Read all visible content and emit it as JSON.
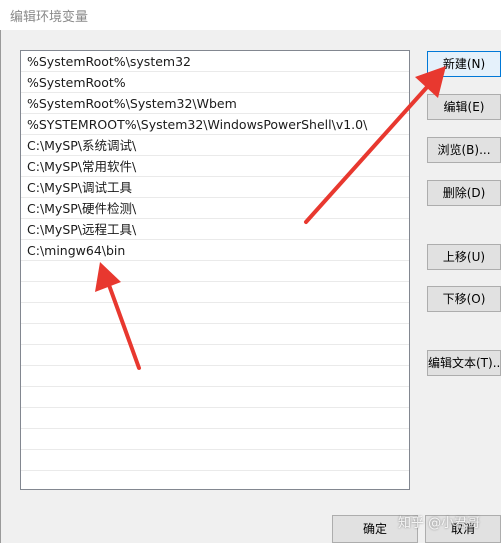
{
  "window": {
    "title": "编辑环境变量"
  },
  "list": {
    "items": [
      "%SystemRoot%\\system32",
      "%SystemRoot%",
      "%SystemRoot%\\System32\\Wbem",
      "%SYSTEMROOT%\\System32\\WindowsPowerShell\\v1.0\\",
      "C:\\MySP\\系统调试\\",
      "C:\\MySP\\常用软件\\",
      "C:\\MySP\\调试工具",
      "C:\\MySP\\硬件检测\\",
      "C:\\MySP\\远程工具\\",
      "C:\\mingw64\\bin",
      "",
      "",
      "",
      "",
      "",
      "",
      "",
      "",
      "",
      ""
    ]
  },
  "buttons": {
    "new": "新建(N)",
    "edit": "编辑(E)",
    "browse": "浏览(B)...",
    "delete": "删除(D)",
    "move_up": "上移(U)",
    "move_down": "下移(O)",
    "edit_text": "编辑文本(T)..."
  },
  "footer": {
    "ok": "确定",
    "cancel": "取消"
  },
  "watermark": "知乎 @小君哥",
  "colors": {
    "annotation_arrow": "#e8382f",
    "primary_button_border": "#0078d7"
  }
}
